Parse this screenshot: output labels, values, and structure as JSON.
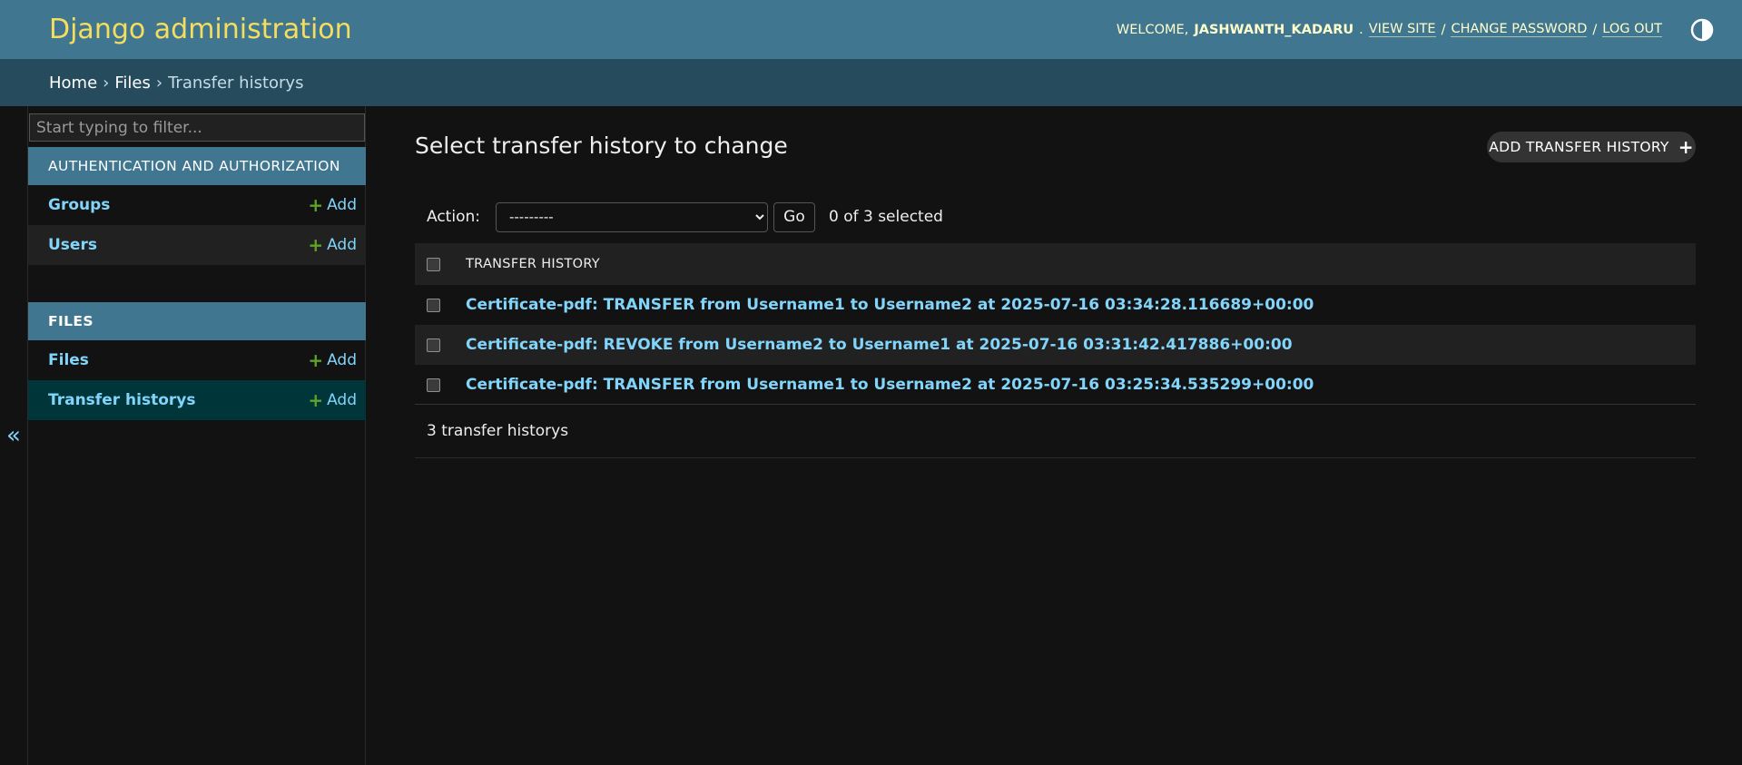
{
  "header": {
    "branding": "Django administration",
    "welcome": "Welcome,",
    "username": "JASHWANTH_KADARU",
    "view_site": "View site",
    "change_password": "Change password",
    "log_out": "Log out",
    "separator": "/"
  },
  "breadcrumbs": {
    "home": "Home",
    "files": "Files",
    "current": "Transfer historys",
    "separator": "›"
  },
  "sidebar": {
    "filter_placeholder": "Start typing to filter...",
    "collapse_icon": "«",
    "apps": [
      {
        "caption": "Authentication and Authorization",
        "models": [
          {
            "name": "Groups",
            "add": "Add"
          },
          {
            "name": "Users",
            "add": "Add"
          }
        ]
      },
      {
        "caption": "Files",
        "models": [
          {
            "name": "Files",
            "add": "Add"
          },
          {
            "name": "Transfer historys",
            "add": "Add"
          }
        ]
      }
    ]
  },
  "content": {
    "title": "Select transfer history to change",
    "add_button": "Add transfer history",
    "action_label": "Action:",
    "action_selected": "---------",
    "go_button": "Go",
    "counter": "0 of 3 selected",
    "column_header": "Transfer history",
    "rows": [
      "Certificate-pdf: TRANSFER from Username1 to Username2 at 2025-07-16 03:34:28.116689+00:00",
      "Certificate-pdf: REVOKE from Username2 to Username1 at 2025-07-16 03:31:42.417886+00:00",
      "Certificate-pdf: TRANSFER from Username1 to Username2 at 2025-07-16 03:25:34.535299+00:00"
    ],
    "paginator": "3 transfer historys"
  },
  "colors": {
    "header_bg": "#417690",
    "breadcrumbs_bg": "#264b5d",
    "branding": "#f5dd5d",
    "link": "#81d4fa",
    "add_plus": "#5fa225",
    "current_row": "#00363a",
    "page_bg": "#121212"
  }
}
